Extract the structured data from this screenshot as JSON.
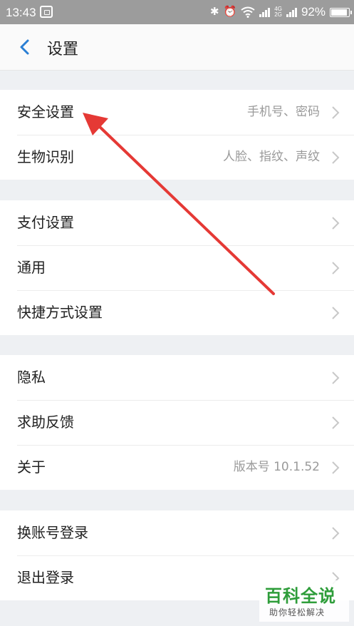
{
  "status_bar": {
    "time": "13:43",
    "network_small_top": "4G",
    "network_small_bottom": "2G",
    "battery": "92%"
  },
  "header": {
    "title": "设置"
  },
  "groups": [
    {
      "items": [
        {
          "label": "安全设置",
          "value": "手机号、密码"
        },
        {
          "label": "生物识别",
          "value": "人脸、指纹、声纹"
        }
      ]
    },
    {
      "items": [
        {
          "label": "支付设置",
          "value": ""
        },
        {
          "label": "通用",
          "value": ""
        },
        {
          "label": "快捷方式设置",
          "value": ""
        }
      ]
    },
    {
      "items": [
        {
          "label": "隐私",
          "value": ""
        },
        {
          "label": "求助反馈",
          "value": ""
        },
        {
          "label": "关于",
          "value": "版本号 10.1.52"
        }
      ]
    },
    {
      "items": [
        {
          "label": "换账号登录",
          "value": ""
        },
        {
          "label": "退出登录",
          "value": ""
        }
      ]
    }
  ],
  "watermark": {
    "title": "百科全说",
    "subtitle": "助你轻松解决"
  },
  "colors": {
    "accent": "#2a7fd4",
    "annotation_arrow": "#e53935",
    "status_bar_bg": "#9c9c9c",
    "page_bg": "#eef0f3"
  }
}
